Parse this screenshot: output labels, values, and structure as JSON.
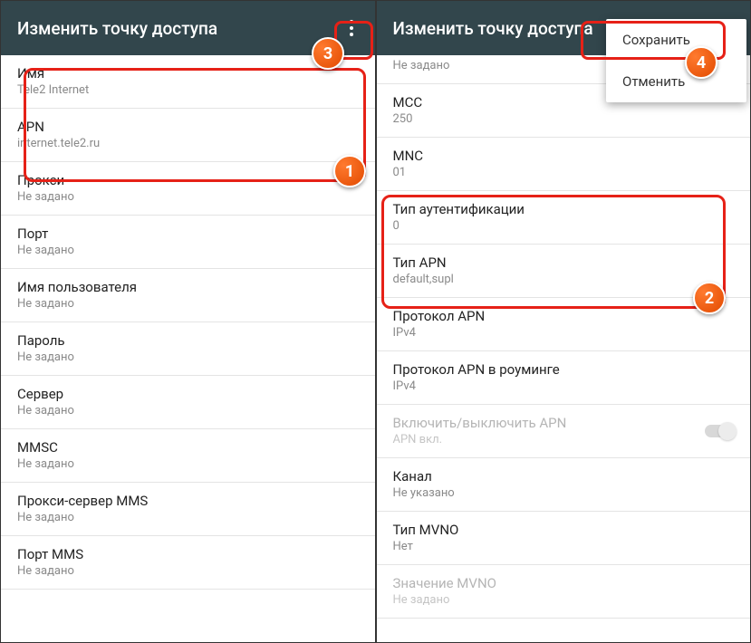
{
  "left": {
    "title": "Изменить точку доступа",
    "items": [
      {
        "label": "Имя",
        "value": "Tele2 Internet"
      },
      {
        "label": "APN",
        "value": "internet.tele2.ru"
      },
      {
        "label": "Прокси",
        "value": "Не задано"
      },
      {
        "label": "Порт",
        "value": "Не задано"
      },
      {
        "label": "Имя пользователя",
        "value": "Не задано"
      },
      {
        "label": "Пароль",
        "value": "Не задано"
      },
      {
        "label": "Сервер",
        "value": "Не задано"
      },
      {
        "label": "MMSC",
        "value": "Не задано"
      },
      {
        "label": "Прокси-сервер MMS",
        "value": "Не задано"
      },
      {
        "label": "Порт MMS",
        "value": "Не задано"
      }
    ]
  },
  "right": {
    "title": "Изменить точку доступа",
    "partial_value": "Не задано",
    "dropdown": {
      "save": "Сохранить",
      "cancel": "Отменить"
    },
    "items": [
      {
        "label": "MCC",
        "value": "250"
      },
      {
        "label": "MNC",
        "value": "01"
      },
      {
        "label": "Тип аутентификации",
        "value": "0"
      },
      {
        "label": "Тип APN",
        "value": "default,supl"
      },
      {
        "label": "Протокол APN",
        "value": "IPv4"
      },
      {
        "label": "Протокол APN в роуминге",
        "value": "IPv4"
      },
      {
        "label": "Включить/выключить APN",
        "value": "APN вкл.",
        "disabled": true,
        "toggle": true
      },
      {
        "label": "Канал",
        "value": "Не указано"
      },
      {
        "label": "Тип MVNO",
        "value": "Нет"
      },
      {
        "label": "Значение MVNO",
        "value": "Не задано",
        "disabled": true
      }
    ]
  },
  "badges": {
    "b1": "1",
    "b2": "2",
    "b3": "3",
    "b4": "4"
  }
}
